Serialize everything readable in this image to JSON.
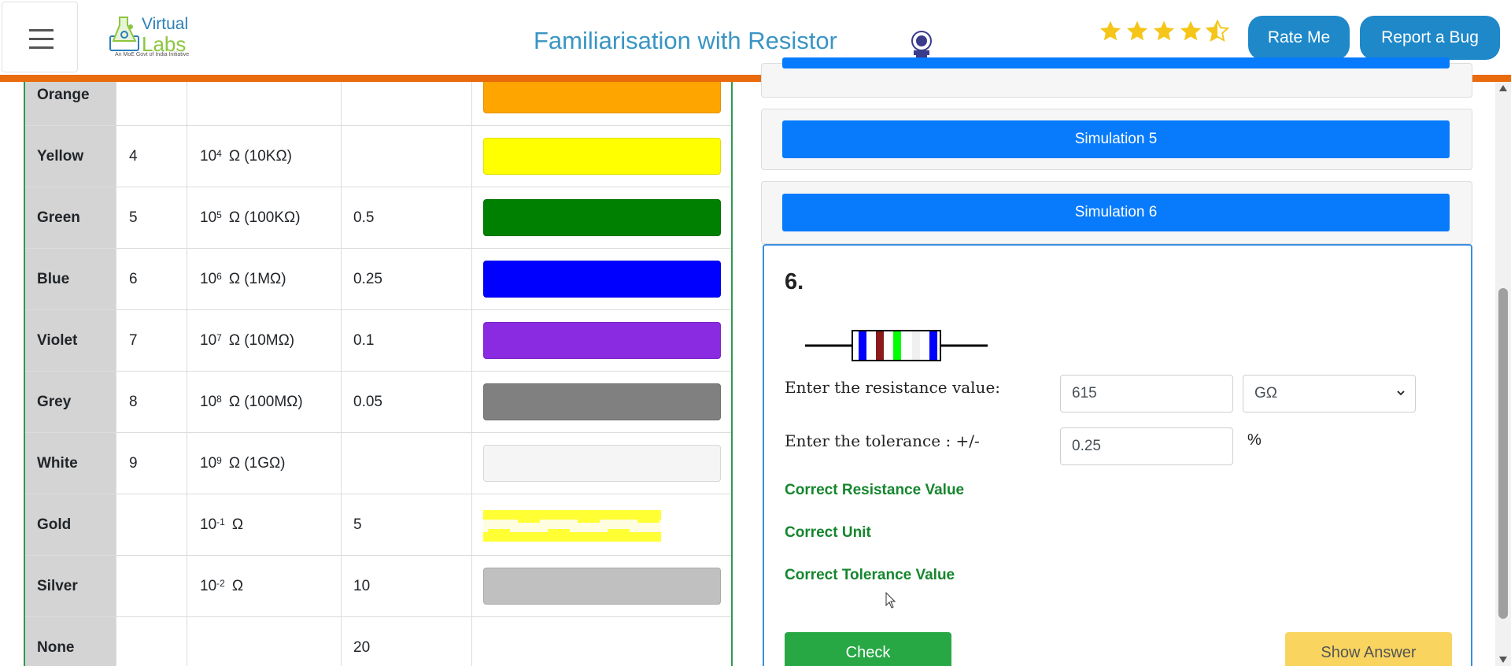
{
  "header": {
    "logo_text_top": "Virtual",
    "logo_text_bottom": "Labs",
    "logo_subtitle": "An MoE Govt of India Initiative",
    "title": "Familiarisation with Resistor",
    "rating_value": 4.5,
    "rating_max": 5,
    "rate_button": "Rate Me",
    "bug_button": "Report a Bug",
    "accent_color": "#e96b0c"
  },
  "color_table": {
    "rows": [
      {
        "name": "Orange",
        "digit": "",
        "mult_base": "",
        "mult_exp": "",
        "mult_suffix": "",
        "tolerance": "",
        "swatch": "#ffa500"
      },
      {
        "name": "Yellow",
        "digit": "4",
        "mult_base": "10",
        "mult_exp": "4",
        "mult_suffix": "Ω (10KΩ)",
        "tolerance": "",
        "swatch": "#ffff00"
      },
      {
        "name": "Green",
        "digit": "5",
        "mult_base": "10",
        "mult_exp": "5",
        "mult_suffix": "Ω (100KΩ)",
        "tolerance": "0.5",
        "swatch": "#008000"
      },
      {
        "name": "Blue",
        "digit": "6",
        "mult_base": "10",
        "mult_exp": "6",
        "mult_suffix": "Ω (1MΩ)",
        "tolerance": "0.25",
        "swatch": "#0000ff"
      },
      {
        "name": "Violet",
        "digit": "7",
        "mult_base": "10",
        "mult_exp": "7",
        "mult_suffix": "Ω (10MΩ)",
        "tolerance": "0.1",
        "swatch": "#8a2be2"
      },
      {
        "name": "Grey",
        "digit": "8",
        "mult_base": "10",
        "mult_exp": "8",
        "mult_suffix": "Ω (100MΩ)",
        "tolerance": "0.05",
        "swatch": "#808080"
      },
      {
        "name": "White",
        "digit": "9",
        "mult_base": "10",
        "mult_exp": "9",
        "mult_suffix": "Ω (1GΩ)",
        "tolerance": "",
        "swatch": "#f5f5f5"
      },
      {
        "name": "Gold",
        "digit": "",
        "mult_base": "10",
        "mult_exp": "-1",
        "mult_suffix": "Ω",
        "tolerance": "5",
        "swatch": "gold-pattern"
      },
      {
        "name": "Silver",
        "digit": "",
        "mult_base": "10",
        "mult_exp": "-2",
        "mult_suffix": "Ω",
        "tolerance": "10",
        "swatch": "#c0c0c0"
      },
      {
        "name": "None",
        "digit": "",
        "mult_base": "",
        "mult_exp": "",
        "mult_suffix": "",
        "tolerance": "20",
        "swatch": ""
      }
    ]
  },
  "simulations": {
    "sim5_label": "Simulation 5",
    "sim6_label": "Simulation 6"
  },
  "question": {
    "number": "6.",
    "resistor_bands": [
      "#0000ff",
      "#8b1a1a",
      "#00ff00",
      "#f0f0f0",
      "#0000ff"
    ],
    "resistance_label": "Enter the resistance value:",
    "resistance_value": "615",
    "unit_selected": "GΩ",
    "tolerance_label": "Enter the tolerance : +/-",
    "tolerance_value": "0.25",
    "tolerance_unit": "%",
    "result_resistance": "Correct Resistance Value",
    "result_unit": "Correct Unit",
    "result_tolerance": "Correct Tolerance Value",
    "check_button": "Check",
    "show_answer_button": "Show Answer",
    "result_color": "#15862e"
  }
}
